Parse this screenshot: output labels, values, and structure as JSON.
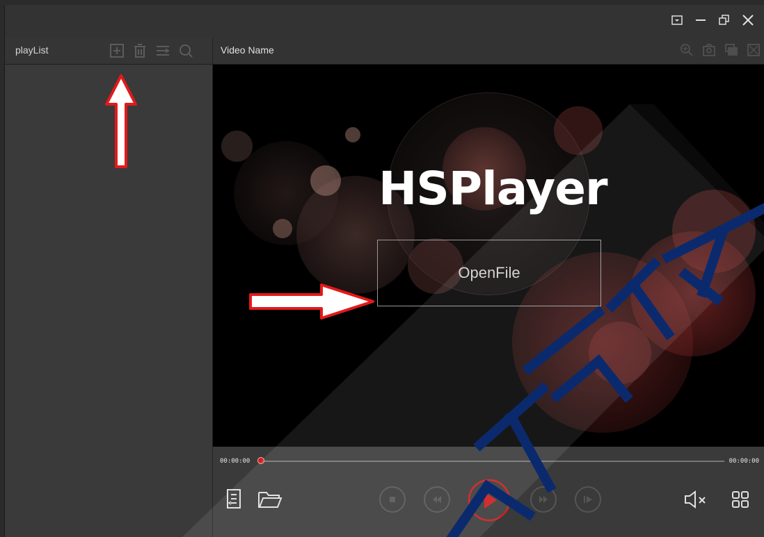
{
  "window": {
    "controls": [
      "dropdown-icon",
      "minimize-icon",
      "restore-icon",
      "close-icon"
    ]
  },
  "playlist": {
    "title": "playList",
    "tools": [
      "add-icon",
      "trash-icon",
      "list-icon",
      "search-icon"
    ]
  },
  "video": {
    "name": "Video Name",
    "tools": [
      "zoom-in-icon",
      "camera-icon",
      "window-icon",
      "fullscreen-icon"
    ],
    "brand": "HSPlayer",
    "open_label": "OpenFile"
  },
  "playback": {
    "current_time": "00:00:00",
    "total_time": "00:00:00",
    "progress": 0
  },
  "colors": {
    "accent": "#d01b1b",
    "panel": "#3a3a3a",
    "titlebar": "#333333"
  }
}
